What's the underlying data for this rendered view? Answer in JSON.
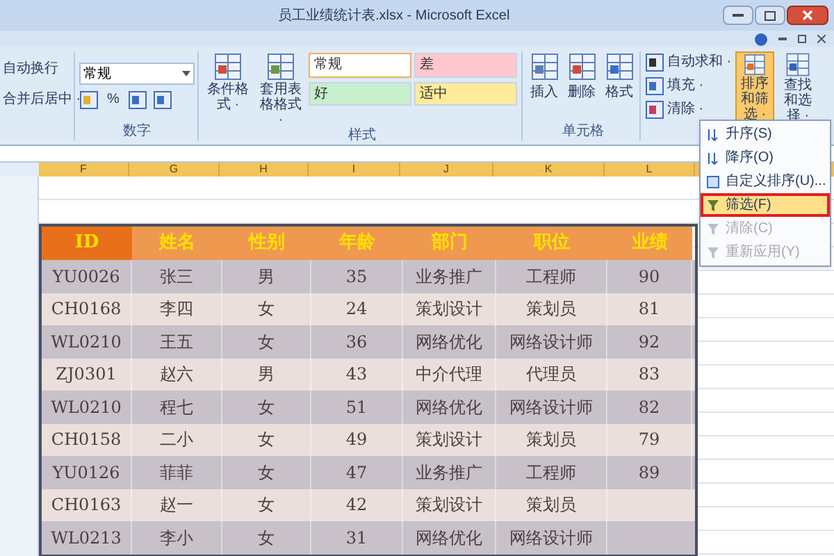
{
  "window": {
    "title": "员工业绩统计表.xlsx - Microsoft Excel"
  },
  "ribbon": {
    "alignment": [
      "自动换行",
      "合并后居中 ·"
    ],
    "number": {
      "title": "数字",
      "format": "常规",
      "buttons": [
        "%"
      ]
    },
    "styles": {
      "title": "样式",
      "buttons": [
        "条件格式 ·",
        "套用表格格式 ·"
      ],
      "cells": [
        {
          "label": "常规",
          "color": "#ffffff"
        },
        {
          "label": "差",
          "color": "#ffc7ce"
        },
        {
          "label": "好",
          "color": "#c6efce"
        },
        {
          "label": "适中",
          "color": "#ffeb9c"
        }
      ]
    },
    "cells": {
      "title": "单元格",
      "buttons": [
        "插入",
        "删除",
        "格式"
      ]
    },
    "editing": {
      "small": [
        "自动求和 ·",
        "填充 ·",
        "清除 ·"
      ],
      "big": [
        {
          "label": "排序和筛选 ·",
          "selected": true
        },
        {
          "label": "查找和选择 ·",
          "selected": false
        }
      ]
    }
  },
  "sheet": {
    "column_letters": [
      "F",
      "G",
      "H",
      "I",
      "J",
      "K",
      "L"
    ]
  },
  "table": {
    "columns": [
      "ID",
      "姓名",
      "性别",
      "年龄",
      "部门",
      "职位",
      "业绩"
    ],
    "rows": [
      [
        "YU0026",
        "张三",
        "男",
        "35",
        "业务推广",
        "工程师",
        "90"
      ],
      [
        "CH0168",
        "李四",
        "女",
        "24",
        "策划设计",
        "策划员",
        "81"
      ],
      [
        "WL0210",
        "王五",
        "女",
        "36",
        "网络优化",
        "网络设计师",
        "92"
      ],
      [
        "ZJ0301",
        "赵六",
        "男",
        "43",
        "中介代理",
        "代理员",
        "83"
      ],
      [
        "WL0210",
        "程七",
        "女",
        "51",
        "网络优化",
        "网络设计师",
        "82"
      ],
      [
        "CH0158",
        "二小",
        "女",
        "49",
        "策划设计",
        "策划员",
        "79"
      ],
      [
        "YU0126",
        "菲菲",
        "女",
        "47",
        "业务推广",
        "工程师",
        "89"
      ],
      [
        "CH0163",
        "赵一",
        "女",
        "42",
        "策划设计",
        "策划员"
      ],
      [
        "WL0213",
        "李小",
        "女",
        "31",
        "网络优化",
        "网络设计师"
      ]
    ]
  },
  "menu": {
    "items": [
      {
        "label": "升序(S)",
        "selected": false,
        "disabled": false
      },
      {
        "label": "降序(O)",
        "selected": false,
        "disabled": false
      },
      {
        "label": "自定义排序(U)...",
        "selected": false,
        "disabled": false
      },
      {
        "label": "筛选(F)",
        "selected": true,
        "disabled": false
      },
      {
        "label": "清除(C)",
        "selected": false,
        "disabled": true
      },
      {
        "label": "重新应用(Y)",
        "selected": false,
        "disabled": true
      }
    ]
  }
}
